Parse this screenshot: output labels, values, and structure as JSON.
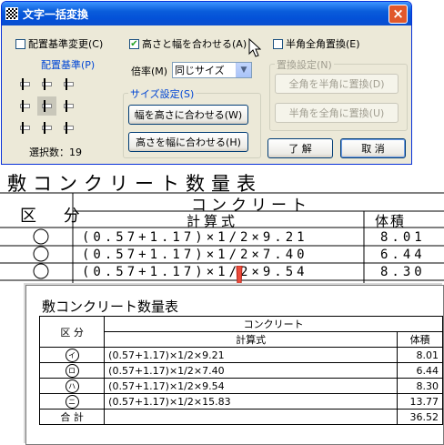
{
  "dialog": {
    "title": "文字一括変換",
    "close_glyph": "×",
    "align_change_label": "配置基準変更(C)",
    "align_change_checked": false,
    "match_height_width_label": "高さと幅を合わせる(A)",
    "match_height_width_checked": true,
    "half_full_label": "半角全角置換(E)",
    "half_full_checked": false,
    "align_base_label": "配置基準(P)",
    "scale_label": "倍率(M)",
    "scale_value": "同じサイズ",
    "replace_setting_label": "置換設定(N)",
    "full_to_half_button": "全角を半角に置換(D)",
    "half_to_full_button": "半角を全角に置換(U)",
    "size_setting_label": "サイズ設定(S)",
    "width_to_height_button": "幅を高さに合わせる(W)",
    "height_to_width_button": "高さを幅に合わせる(H)",
    "ok_button": "了 解",
    "cancel_button": "取 消",
    "selected_count": "選択数：19"
  },
  "background": {
    "title": "敷コンクリート数量表",
    "concrete_header": "コンクリート",
    "division_header": "区 分",
    "formula_header": "計算式",
    "volume_header": "体積",
    "rows": [
      {
        "formula": "(0.57+1.17)×1/2×9.21",
        "volume": "8.01"
      },
      {
        "formula": "(0.57+1.17)×1/2×7.40",
        "volume": "6.44"
      },
      {
        "formula": "(0.57+1.17)×1/2×9.54",
        "volume": "8.30"
      }
    ]
  },
  "front": {
    "title": "敷コンクリート数量表",
    "concrete_header": "コンクリート",
    "division_header": "区 分",
    "formula_header": "計算式",
    "volume_header": "体積",
    "rows": [
      {
        "mark": "イ",
        "formula": "(0.57+1.17)×1/2×9.21",
        "volume": "8.01"
      },
      {
        "mark": "ロ",
        "formula": "(0.57+1.17)×1/2×7.40",
        "volume": "6.44"
      },
      {
        "mark": "ハ",
        "formula": "(0.57+1.17)×1/2×9.54",
        "volume": "8.30"
      },
      {
        "mark": "ニ",
        "formula": "(0.57+1.17)×1/2×15.83",
        "volume": "13.77"
      }
    ],
    "total_label": "合 計",
    "total_value": "36.52"
  },
  "colors": {
    "titlebar": "#0a5ddb",
    "group_label": "#0046d5",
    "arrow": "#ea4b3c",
    "check": "#21a121"
  },
  "icons": {
    "app": "checker-icon",
    "close": "close-icon",
    "combo": "chevron-down-icon",
    "cursor": "mouse-pointer-icon",
    "arrow": "red-down-arrow-icon"
  }
}
